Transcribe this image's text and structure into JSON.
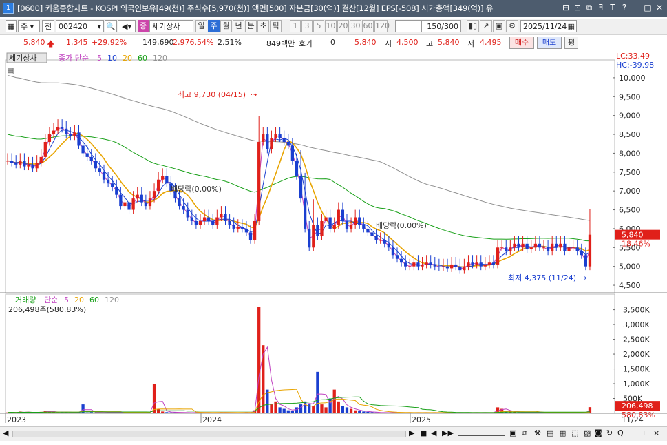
{
  "window": {
    "number": "1",
    "title": "[0600] 키움종합차트 - KOSPI 외국인보유[49(천)] 주식수[5,970(천)] 액면[500] 자본금[30(억)] 결산[12월] EPS[-508] 시가총액[349(억)] 유"
  },
  "toolbar": {
    "period_type": "주",
    "prev_label": "전",
    "stock_code": "002420",
    "stock_name": "세기상사",
    "tag": "증",
    "periods": [
      "일",
      "주",
      "월",
      "년",
      "분",
      "초",
      "틱"
    ],
    "selected_period": "주",
    "minute_values": [
      "1",
      "3",
      "5",
      "10",
      "20",
      "30",
      "60",
      "120"
    ],
    "count": "150/300",
    "date": "2025/11/24"
  },
  "info": {
    "price": "5,840",
    "change": "1,345",
    "change_pct": "+29.92%",
    "volume": "149,690",
    "volume_ratio": "2,976.54%",
    "turnover": "2.51%",
    "amount": "849백만",
    "hoga_label": "호가",
    "hoga_value": "0",
    "hoga_price": "5,840",
    "open_label": "시",
    "open": "4,500",
    "high_label": "고",
    "high": "5,840",
    "low_label": "저",
    "low": "4,495",
    "buy_label": "매수",
    "sell_label": "매도",
    "eval_label": "평"
  },
  "legend": {
    "price_name": "세기상사",
    "ma_label": "종가 단순",
    "ma_periods": [
      "5",
      "10",
      "20",
      "60",
      "120"
    ],
    "vol_name": "거래량",
    "vol_ma_label": "단순",
    "vol_ma_periods": [
      "5",
      "20",
      "60",
      "120"
    ],
    "vol_current": "206,498주(580.83%)"
  },
  "annotations": {
    "high": "최고 9,730 (04/15)",
    "low": "최저 4,375 (11/24)",
    "ex_div": "배당락(0.00%)"
  },
  "right_axis": {
    "lc": "LC:33.49",
    "hc": "HC:-39.98",
    "price_ticks": [
      "10,000",
      "9,500",
      "9,000",
      "8,500",
      "8,000",
      "7,500",
      "7,000",
      "6,500",
      "6,000",
      "5,500",
      "5,000",
      "4,500"
    ],
    "last_price": "5,840",
    "last_pct": "18.46%",
    "vol_ticks": [
      "3,500K",
      "3,000K",
      "2,500K",
      "2,000K",
      "1,500K",
      "1,000K",
      "500K"
    ],
    "last_vol": "206,498",
    "last_vol_pct": "580.83%"
  },
  "x_axis": {
    "labels": [
      "2023",
      "2024",
      "2025"
    ],
    "right_label": "11/24"
  },
  "colors": {
    "up": "#e0201a",
    "down": "#1a3fd0",
    "ma5": "#c040c0",
    "ma10": "#1a3fd0",
    "ma20": "#e8a400",
    "ma60": "#18a018",
    "ma120": "#909090"
  },
  "chart_data": {
    "type": "candlestick",
    "price_range": [
      4300,
      10400
    ],
    "volume_range": [
      0,
      3700000
    ],
    "weekly_closes": [
      7800,
      7750,
      7700,
      7800,
      7650,
      7700,
      7600,
      7750,
      7900,
      8300,
      8500,
      8600,
      8700,
      8650,
      8500,
      8450,
      8550,
      8200,
      8000,
      7900,
      7800,
      7600,
      7500,
      7300,
      7200,
      7100,
      6900,
      6600,
      6700,
      6500,
      6800,
      6900,
      6700,
      6600,
      6800,
      7000,
      7300,
      7400,
      7200,
      7000,
      6800,
      6600,
      6500,
      6300,
      6200,
      6100,
      6200,
      6300,
      6200,
      6100,
      6300,
      6400,
      6200,
      6100,
      6000,
      6050,
      6000,
      5900,
      5700,
      6200,
      8300,
      8500,
      8100,
      8400,
      8500,
      8400,
      8300,
      8200,
      7800,
      7400,
      6800,
      6000,
      5500,
      6100,
      5800,
      6200,
      6300,
      6000,
      6100,
      6500,
      6200,
      6000,
      6100,
      6300,
      6100,
      6000,
      5900,
      5800,
      5700,
      5700,
      5600,
      5500,
      5300,
      5200,
      5100,
      5000,
      5000,
      5100,
      5000,
      5050,
      5100,
      5050,
      5000,
      4980,
      5000,
      4950,
      5050,
      5000,
      4900,
      5000,
      5100,
      5050,
      5100,
      5000,
      5050,
      5100,
      5050,
      5500,
      5500,
      5400,
      5500,
      5600,
      5500,
      5600,
      5450,
      5500,
      5600,
      5500,
      5500,
      5400,
      5600,
      5500,
      5600,
      5400,
      5500,
      5500,
      5400,
      5300,
      5000,
      5840
    ],
    "weekly_volumes": [
      30000,
      40000,
      20000,
      60000,
      30000,
      40000,
      30000,
      20000,
      50000,
      80000,
      60000,
      40000,
      30000,
      50000,
      40000,
      30000,
      20000,
      40000,
      300000,
      30000,
      40000,
      20000,
      30000,
      20000,
      30000,
      40000,
      20000,
      30000,
      50000,
      40000,
      30000,
      20000,
      40000,
      30000,
      20000,
      1000000,
      150000,
      60000,
      40000,
      30000,
      40000,
      30000,
      20000,
      30000,
      20000,
      30000,
      40000,
      20000,
      30000,
      20000,
      30000,
      40000,
      30000,
      20000,
      30000,
      20000,
      30000,
      40000,
      20000,
      100000,
      3600000,
      2300000,
      800000,
      300000,
      400000,
      200000,
      150000,
      100000,
      80000,
      200000,
      300000,
      400000,
      300000,
      250000,
      1400000,
      300000,
      200000,
      500000,
      800000,
      400000,
      250000,
      200000,
      150000,
      100000,
      80000,
      60000,
      50000,
      40000,
      30000,
      20000,
      30000,
      20000,
      30000,
      20000,
      30000,
      20000,
      30000,
      20000,
      30000,
      20000,
      30000,
      20000,
      30000,
      20000,
      30000,
      20000,
      30000,
      20000,
      30000,
      20000,
      30000,
      20000,
      30000,
      20000,
      30000,
      20000,
      30000,
      200000,
      150000,
      80000,
      60000,
      40000,
      30000,
      20000,
      40000,
      30000,
      20000,
      30000,
      20000,
      40000,
      30000,
      20000,
      30000,
      20000,
      30000,
      20000,
      30000,
      20000,
      40000,
      206498
    ]
  },
  "statusbar": {
    "nav": [
      "▶",
      "■",
      "◀",
      "▶▶"
    ],
    "zoom_out": "−",
    "zoom_in": "+",
    "search": "Q",
    "close": "×"
  }
}
